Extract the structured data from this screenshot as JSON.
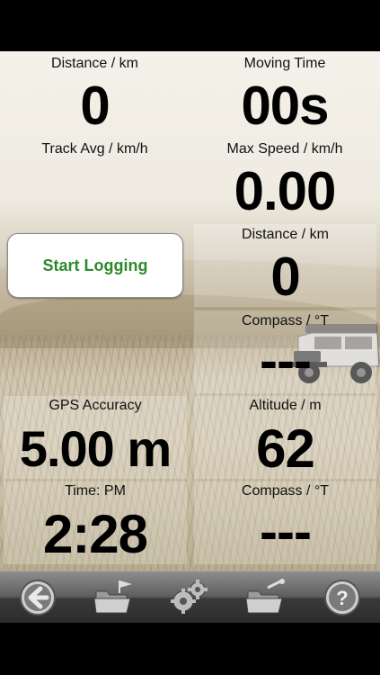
{
  "tiles": {
    "distance_km": {
      "label": "Distance / km",
      "value": "0"
    },
    "moving_time": {
      "label": "Moving Time",
      "value": "00s"
    },
    "track_avg": {
      "label": "Track Avg / km/h",
      "value": ""
    },
    "max_speed": {
      "label": "Max Speed / km/h",
      "value": "0.00"
    },
    "distance_km_2": {
      "label": "Distance / km",
      "value": "0"
    },
    "compass_1": {
      "label": "Compass / °T",
      "value": "---"
    },
    "gps_accuracy": {
      "label": "GPS Accuracy",
      "value": "5.00 m"
    },
    "altitude": {
      "label": "Altitude / m",
      "value": "62"
    },
    "time": {
      "label": "Time: PM",
      "value": "2:28"
    },
    "compass_2": {
      "label": "Compass / °T",
      "value": "---"
    }
  },
  "start_button": {
    "label": "Start Logging",
    "color": "#2c8a2c"
  },
  "toolbar": {
    "icons": [
      "back-arrow-icon",
      "folder-flag-icon",
      "gears-icon",
      "folder-export-icon",
      "help-icon"
    ]
  },
  "colors": {
    "value_text": "#000000",
    "label_text": "#111111",
    "toolbar": "#3a3a3a"
  }
}
